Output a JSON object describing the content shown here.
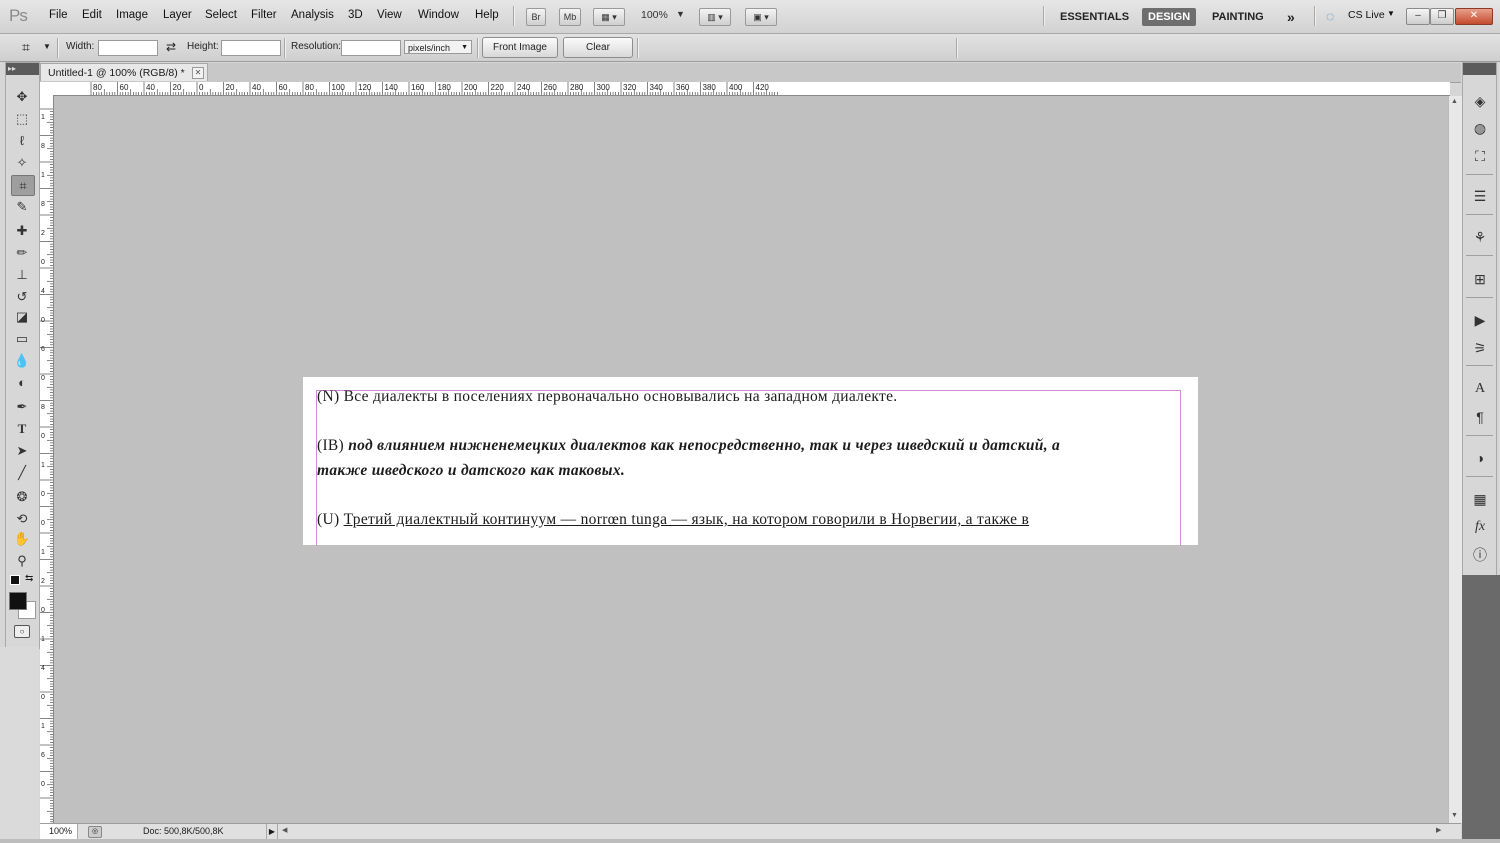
{
  "app": {
    "logo": "Ps",
    "menus": [
      "File",
      "Edit",
      "Image",
      "Layer",
      "Select",
      "Filter",
      "Analysis",
      "3D",
      "View",
      "Window",
      "Help"
    ],
    "bridge_button": "Br",
    "minibridge_button": "Mb",
    "zoom_level": "100%",
    "workspaces": [
      "ESSENTIALS",
      "DESIGN",
      "PAINTING"
    ],
    "active_workspace": "DESIGN",
    "more_workspaces": "»",
    "cs_live": "CS Live"
  },
  "options_bar": {
    "width_label": "Width:",
    "width_value": "",
    "swap_icon": "⇄",
    "height_label": "Height:",
    "height_value": "",
    "resolution_label": "Resolution:",
    "resolution_value": "",
    "resolution_unit": "pixels/inch",
    "front_image_label": "Front Image",
    "clear_label": "Clear"
  },
  "document": {
    "tab_title": "Untitled-1 @ 100% (RGB/8) *",
    "hruler_labels": [
      "80",
      "60",
      "40",
      "20",
      "0",
      "20",
      "40",
      "60",
      "80",
      "100",
      "120",
      "140",
      "160",
      "180",
      "200",
      "220",
      "240",
      "260",
      "280",
      "300",
      "320",
      "340",
      "360",
      "380",
      "400",
      "420"
    ],
    "vruler_labels": [
      "1",
      "8",
      "1",
      "8",
      "2",
      "0",
      "4",
      "0",
      "6",
      "0",
      "8",
      "0",
      "1",
      "0",
      "0",
      "1",
      "2",
      "0",
      "1",
      "4",
      "0",
      "1",
      "6",
      "0"
    ],
    "lines": [
      {
        "prefix": "(N) ",
        "text": "Все диалекты в поселениях первоначально основывались на западном диалекте.",
        "style": "normal"
      },
      {
        "prefix": "(IB) ",
        "text": "под влиянием нижненемецких диалектов как непосредственно, так и через шведский и датский, а",
        "style": "bold-italic"
      },
      {
        "prefix": "",
        "text": "также шведского и датского как таковых.",
        "style": "bold-italic"
      },
      {
        "prefix": "(U) ",
        "text": "Третий диалектный континуум — norrœn tunga — язык, на котором говорили в Норвегии, а также в ",
        "style": "underline"
      }
    ]
  },
  "status": {
    "zoom": "100%",
    "doc_info": "Doc: 500,8K/500,8K"
  }
}
